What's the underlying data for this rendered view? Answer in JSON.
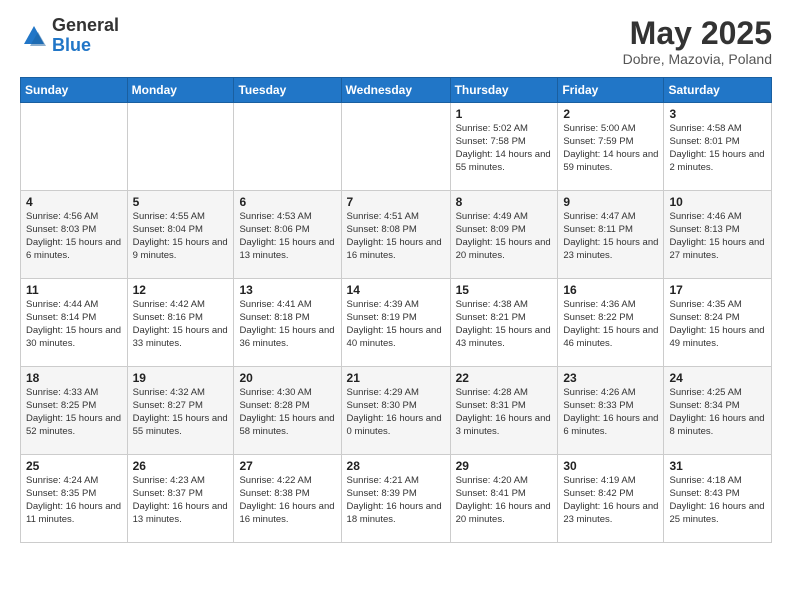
{
  "logo": {
    "general": "General",
    "blue": "Blue"
  },
  "title": {
    "month": "May 2025",
    "location": "Dobre, Mazovia, Poland"
  },
  "weekdays": [
    "Sunday",
    "Monday",
    "Tuesday",
    "Wednesday",
    "Thursday",
    "Friday",
    "Saturday"
  ],
  "weeks": [
    [
      {
        "day": "",
        "info": ""
      },
      {
        "day": "",
        "info": ""
      },
      {
        "day": "",
        "info": ""
      },
      {
        "day": "",
        "info": ""
      },
      {
        "day": "1",
        "info": "Sunrise: 5:02 AM\nSunset: 7:58 PM\nDaylight: 14 hours and 55 minutes."
      },
      {
        "day": "2",
        "info": "Sunrise: 5:00 AM\nSunset: 7:59 PM\nDaylight: 14 hours and 59 minutes."
      },
      {
        "day": "3",
        "info": "Sunrise: 4:58 AM\nSunset: 8:01 PM\nDaylight: 15 hours and 2 minutes."
      }
    ],
    [
      {
        "day": "4",
        "info": "Sunrise: 4:56 AM\nSunset: 8:03 PM\nDaylight: 15 hours and 6 minutes."
      },
      {
        "day": "5",
        "info": "Sunrise: 4:55 AM\nSunset: 8:04 PM\nDaylight: 15 hours and 9 minutes."
      },
      {
        "day": "6",
        "info": "Sunrise: 4:53 AM\nSunset: 8:06 PM\nDaylight: 15 hours and 13 minutes."
      },
      {
        "day": "7",
        "info": "Sunrise: 4:51 AM\nSunset: 8:08 PM\nDaylight: 15 hours and 16 minutes."
      },
      {
        "day": "8",
        "info": "Sunrise: 4:49 AM\nSunset: 8:09 PM\nDaylight: 15 hours and 20 minutes."
      },
      {
        "day": "9",
        "info": "Sunrise: 4:47 AM\nSunset: 8:11 PM\nDaylight: 15 hours and 23 minutes."
      },
      {
        "day": "10",
        "info": "Sunrise: 4:46 AM\nSunset: 8:13 PM\nDaylight: 15 hours and 27 minutes."
      }
    ],
    [
      {
        "day": "11",
        "info": "Sunrise: 4:44 AM\nSunset: 8:14 PM\nDaylight: 15 hours and 30 minutes."
      },
      {
        "day": "12",
        "info": "Sunrise: 4:42 AM\nSunset: 8:16 PM\nDaylight: 15 hours and 33 minutes."
      },
      {
        "day": "13",
        "info": "Sunrise: 4:41 AM\nSunset: 8:18 PM\nDaylight: 15 hours and 36 minutes."
      },
      {
        "day": "14",
        "info": "Sunrise: 4:39 AM\nSunset: 8:19 PM\nDaylight: 15 hours and 40 minutes."
      },
      {
        "day": "15",
        "info": "Sunrise: 4:38 AM\nSunset: 8:21 PM\nDaylight: 15 hours and 43 minutes."
      },
      {
        "day": "16",
        "info": "Sunrise: 4:36 AM\nSunset: 8:22 PM\nDaylight: 15 hours and 46 minutes."
      },
      {
        "day": "17",
        "info": "Sunrise: 4:35 AM\nSunset: 8:24 PM\nDaylight: 15 hours and 49 minutes."
      }
    ],
    [
      {
        "day": "18",
        "info": "Sunrise: 4:33 AM\nSunset: 8:25 PM\nDaylight: 15 hours and 52 minutes."
      },
      {
        "day": "19",
        "info": "Sunrise: 4:32 AM\nSunset: 8:27 PM\nDaylight: 15 hours and 55 minutes."
      },
      {
        "day": "20",
        "info": "Sunrise: 4:30 AM\nSunset: 8:28 PM\nDaylight: 15 hours and 58 minutes."
      },
      {
        "day": "21",
        "info": "Sunrise: 4:29 AM\nSunset: 8:30 PM\nDaylight: 16 hours and 0 minutes."
      },
      {
        "day": "22",
        "info": "Sunrise: 4:28 AM\nSunset: 8:31 PM\nDaylight: 16 hours and 3 minutes."
      },
      {
        "day": "23",
        "info": "Sunrise: 4:26 AM\nSunset: 8:33 PM\nDaylight: 16 hours and 6 minutes."
      },
      {
        "day": "24",
        "info": "Sunrise: 4:25 AM\nSunset: 8:34 PM\nDaylight: 16 hours and 8 minutes."
      }
    ],
    [
      {
        "day": "25",
        "info": "Sunrise: 4:24 AM\nSunset: 8:35 PM\nDaylight: 16 hours and 11 minutes."
      },
      {
        "day": "26",
        "info": "Sunrise: 4:23 AM\nSunset: 8:37 PM\nDaylight: 16 hours and 13 minutes."
      },
      {
        "day": "27",
        "info": "Sunrise: 4:22 AM\nSunset: 8:38 PM\nDaylight: 16 hours and 16 minutes."
      },
      {
        "day": "28",
        "info": "Sunrise: 4:21 AM\nSunset: 8:39 PM\nDaylight: 16 hours and 18 minutes."
      },
      {
        "day": "29",
        "info": "Sunrise: 4:20 AM\nSunset: 8:41 PM\nDaylight: 16 hours and 20 minutes."
      },
      {
        "day": "30",
        "info": "Sunrise: 4:19 AM\nSunset: 8:42 PM\nDaylight: 16 hours and 23 minutes."
      },
      {
        "day": "31",
        "info": "Sunrise: 4:18 AM\nSunset: 8:43 PM\nDaylight: 16 hours and 25 minutes."
      }
    ]
  ]
}
